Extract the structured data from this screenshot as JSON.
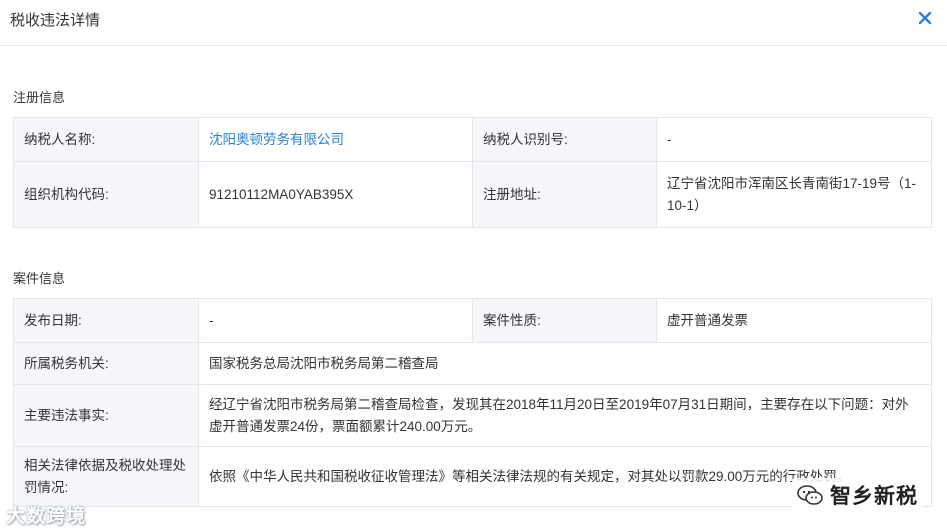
{
  "dialog": {
    "title": "税收违法详情",
    "close_icon": "close-icon"
  },
  "registration": {
    "section_title": "注册信息",
    "taxpayer_name_label": "纳税人名称:",
    "taxpayer_name_value": "沈阳奥顿劳务有限公司",
    "taxpayer_id_label": "纳税人识别号:",
    "taxpayer_id_value": "-",
    "org_code_label": "组织机构代码:",
    "org_code_value": "91210112MA0YAB395X",
    "address_label": "注册地址:",
    "address_value": "辽宁省沈阳市浑南区长青南街17-19号（1-10-1）"
  },
  "case": {
    "section_title": "案件信息",
    "publish_date_label": "发布日期:",
    "publish_date_value": "-",
    "case_nature_label": "案件性质:",
    "case_nature_value": "虚开普通发票",
    "tax_authority_label": "所属税务机关:",
    "tax_authority_value": "国家税务总局沈阳市税务局第二稽查局",
    "main_facts_label": "主要违法事实:",
    "main_facts_value": "经辽宁省沈阳市税务局第二稽查局检查，发现其在2018年11月20日至2019年07月31日期间，主要存在以下问题：对外虚开普通发票24份，票面额累计240.00万元。",
    "penalty_label": "相关法律依据及税收处理处罚情况:",
    "penalty_value": "依照《中华人民共和国税收征收管理法》等相关法律法规的有关规定，对其处以罚款29.00万元的行政处罚。"
  },
  "watermarks": {
    "left_text": "大数跨境",
    "right_text": "智乡新税"
  }
}
